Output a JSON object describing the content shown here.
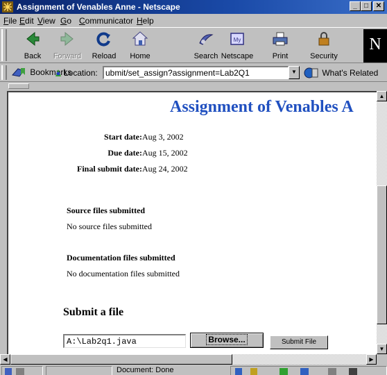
{
  "window": {
    "title": "Assignment of Venables Anne - Netscape",
    "controls": {
      "minimize": "_",
      "maximize": "□",
      "close": "✕"
    }
  },
  "menu": [
    {
      "label": "File",
      "mnemonic": "F"
    },
    {
      "label": "Edit",
      "mnemonic": "E"
    },
    {
      "label": "View",
      "mnemonic": "V"
    },
    {
      "label": "Go",
      "mnemonic": "G"
    },
    {
      "label": "Communicator",
      "mnemonic": "C"
    },
    {
      "label": "Help",
      "mnemonic": "H"
    }
  ],
  "toolbar": {
    "buttons": [
      {
        "label": "Back",
        "icon": "back-arrow-icon",
        "enabled": true
      },
      {
        "label": "Forward",
        "icon": "forward-arrow-icon",
        "enabled": false
      },
      {
        "label": "Reload",
        "icon": "reload-icon",
        "enabled": true
      },
      {
        "label": "Home",
        "icon": "home-icon",
        "enabled": true
      },
      {
        "label": "Search",
        "icon": "search-icon",
        "enabled": true
      },
      {
        "label": "Netscape",
        "icon": "my-netscape-icon",
        "enabled": true
      },
      {
        "label": "Print",
        "icon": "print-icon",
        "enabled": true
      },
      {
        "label": "Security",
        "icon": "security-lock-icon",
        "enabled": true
      }
    ],
    "logo": "N"
  },
  "location_bar": {
    "bookmarks_label": "Bookmarks",
    "location_label": "Location:",
    "url": "ubmit/set_assign?assignment=Lab2Q1",
    "whats_related_label": "What's Related"
  },
  "page": {
    "title": "Assignment of Venables A",
    "dates": [
      {
        "label": "Start date:",
        "value": "Aug 3, 2002"
      },
      {
        "label": "Due date:",
        "value": "Aug 15, 2002"
      },
      {
        "label": "Final submit date:",
        "value": "Aug 24, 2002"
      }
    ],
    "source_section": {
      "heading": "Source files submitted",
      "text": "No source files submitted"
    },
    "doc_section": {
      "heading": "Documentation files submitted",
      "text": "No documentation files submitted"
    },
    "submit": {
      "heading": "Submit a file",
      "file_value": "A:\\Lab2q1.java",
      "browse_label": "Browse...",
      "submit_label": "Submit File"
    }
  },
  "status": {
    "text": "Document: Done"
  },
  "colors": {
    "title_bar": "#0a246a",
    "page_title": "#2050c0",
    "chrome": "#c0c0c0"
  }
}
